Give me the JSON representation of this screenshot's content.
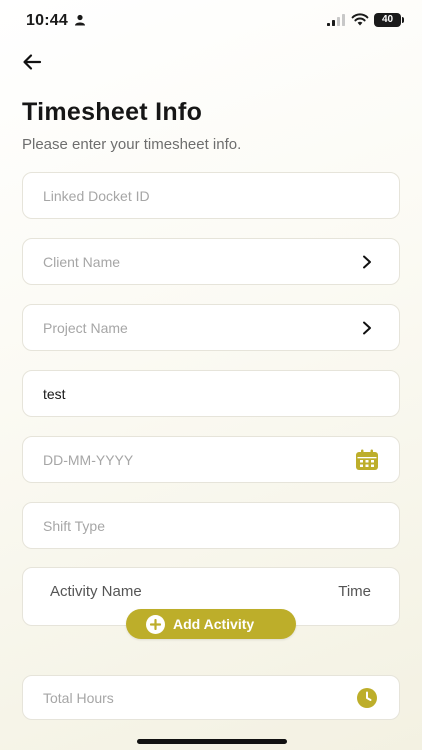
{
  "status_bar": {
    "time": "10:44",
    "battery": "40"
  },
  "header": {
    "title": "Timesheet Info",
    "subtitle": "Please enter your timesheet info."
  },
  "form": {
    "linked_docket_id": {
      "placeholder": "Linked Docket ID",
      "value": ""
    },
    "client_name": {
      "placeholder": "Client Name",
      "value": ""
    },
    "project_name": {
      "placeholder": "Project Name",
      "value": ""
    },
    "text_field": {
      "value": "test"
    },
    "date": {
      "placeholder": "DD-MM-YYYY",
      "value": ""
    },
    "shift_type": {
      "placeholder": "Shift Type",
      "value": ""
    },
    "total_hours": {
      "placeholder": "Total Hours",
      "value": ""
    }
  },
  "activity_table": {
    "col_activity": "Activity Name",
    "col_time": "Time",
    "add_button_label": "Add Activity"
  },
  "icons": {
    "back": "arrow-left-icon",
    "chevron": "chevron-right-icon",
    "calendar": "calendar-icon",
    "clock": "clock-icon",
    "plus": "plus-circle-icon"
  },
  "colors": {
    "accent": "#bdae2a",
    "placeholder": "#a6a6a6",
    "field_border": "#e6e4da"
  }
}
